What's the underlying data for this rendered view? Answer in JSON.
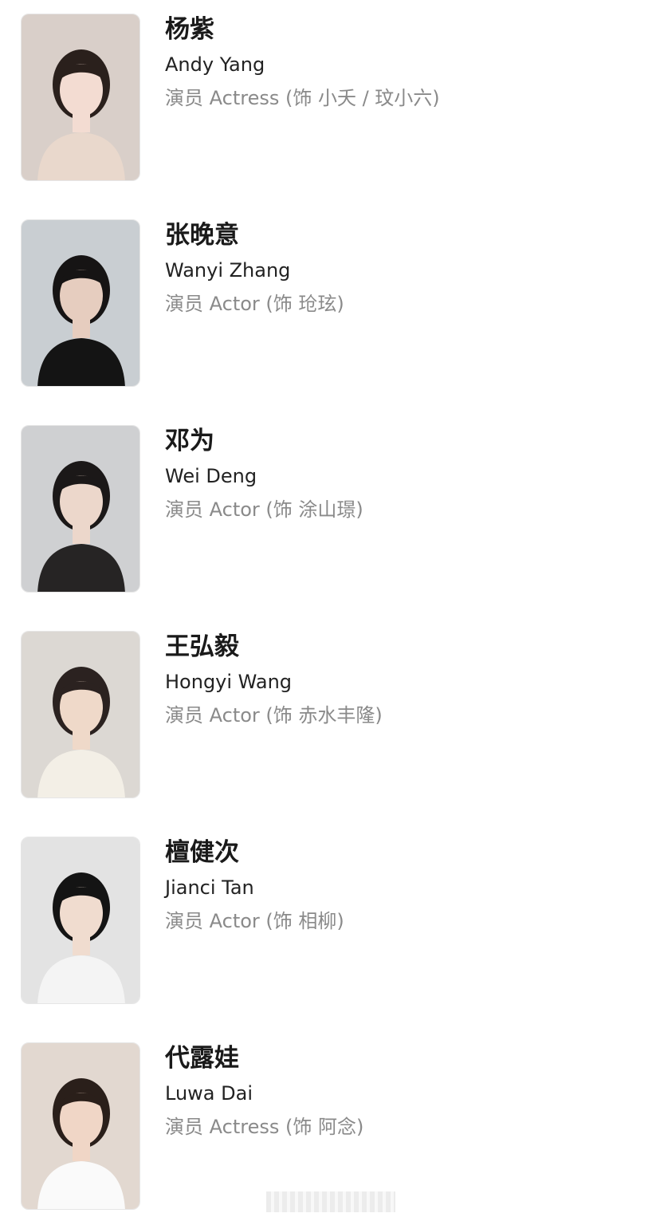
{
  "cast": [
    {
      "name_cn": "杨紫",
      "name_en": "Andy Yang",
      "role": "演员 Actress (饰 小夭 / 玟小六)",
      "photo": {
        "bg": "#d9cfc9",
        "skin": "#f3dcd2",
        "hair": "#2a201c",
        "cloth": "#e9d8cc"
      }
    },
    {
      "name_cn": "张晚意",
      "name_en": "Wanyi Zhang",
      "role": "演员 Actor (饰 玱玹)",
      "photo": {
        "bg": "#c9ced2",
        "skin": "#e6cdbf",
        "hair": "#161414",
        "cloth": "#141414"
      }
    },
    {
      "name_cn": "邓为",
      "name_en": "Wei Deng",
      "role": "演员 Actor (饰 涂山璟)",
      "photo": {
        "bg": "#cfd0d2",
        "skin": "#ecd7cb",
        "hair": "#1b1818",
        "cloth": "#262424"
      }
    },
    {
      "name_cn": "王弘毅",
      "name_en": "Hongyi Wang",
      "role": "演员 Actor (饰 赤水丰隆)",
      "photo": {
        "bg": "#dcd8d3",
        "skin": "#efd9c9",
        "hair": "#2b2220",
        "cloth": "#f3efe6"
      }
    },
    {
      "name_cn": "檀健次",
      "name_en": "Jianci Tan",
      "role": "演员 Actor (饰 相柳)",
      "photo": {
        "bg": "#e3e3e3",
        "skin": "#f0dccf",
        "hair": "#141414",
        "cloth": "#f4f4f4"
      }
    },
    {
      "name_cn": "代露娃",
      "name_en": "Luwa Dai",
      "role": "演员 Actress (饰 阿念)",
      "photo": {
        "bg": "#e2d8d0",
        "skin": "#f0d6c6",
        "hair": "#2a1f1a",
        "cloth": "#fafafa"
      }
    }
  ]
}
